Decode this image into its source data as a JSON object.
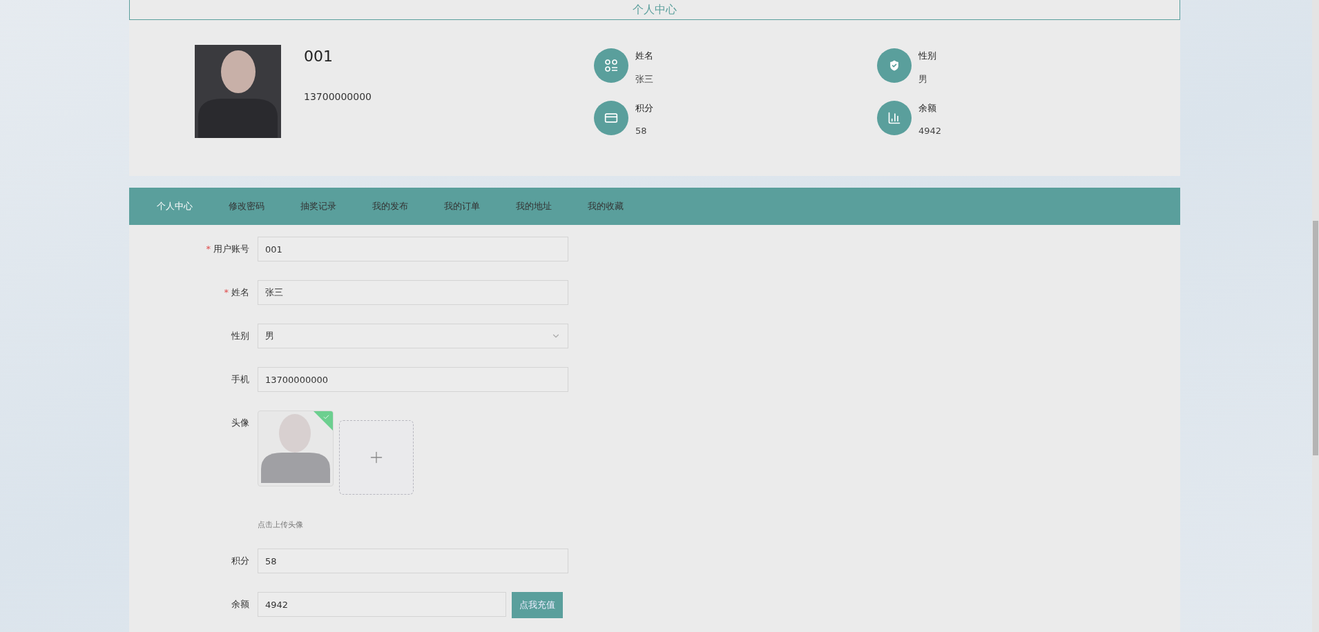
{
  "page_title": "个人中心",
  "profile": {
    "account": "001",
    "phone": "13700000000",
    "stats": [
      {
        "kind": "name",
        "label": "姓名",
        "value": "张三"
      },
      {
        "kind": "gender",
        "label": "性别",
        "value": "男"
      },
      {
        "kind": "points",
        "label": "积分",
        "value": "58"
      },
      {
        "kind": "balance",
        "label": "余额",
        "value": "4942"
      }
    ]
  },
  "tabs": [
    {
      "label": "个人中心",
      "selected": true
    },
    {
      "label": "修改密码",
      "selected": false
    },
    {
      "label": "抽奖记录",
      "selected": false
    },
    {
      "label": "我的发布",
      "selected": false
    },
    {
      "label": "我的订单",
      "selected": false
    },
    {
      "label": "我的地址",
      "selected": false
    },
    {
      "label": "我的收藏",
      "selected": false
    }
  ],
  "form": {
    "required_mark": "*",
    "fields": [
      {
        "kind": "text",
        "label": "用户账号",
        "required": true,
        "value": "001"
      },
      {
        "kind": "text",
        "label": "姓名",
        "required": true,
        "value": "张三"
      },
      {
        "kind": "select",
        "label": "性别",
        "required": false,
        "value": "男"
      },
      {
        "kind": "text",
        "label": "手机",
        "required": false,
        "value": "13700000000"
      },
      {
        "kind": "image",
        "label": "头像",
        "required": false,
        "uploaded": true,
        "hint": "点击上传头像"
      },
      {
        "kind": "text",
        "label": "积分",
        "required": false,
        "value": "58"
      },
      {
        "kind": "action",
        "label": "余额",
        "required": false,
        "value": "4942",
        "button": "点我充值"
      }
    ]
  }
}
